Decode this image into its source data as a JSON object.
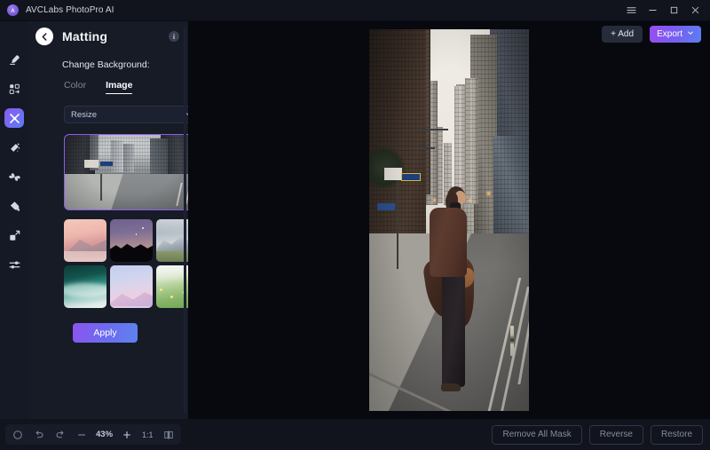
{
  "titlebar": {
    "app_name": "AVCLabs PhotoPro AI",
    "logo_icon": "app-logo-icon",
    "controls": [
      {
        "name": "menu-icon",
        "label": "☰"
      },
      {
        "name": "minimize-icon",
        "label": "─"
      },
      {
        "name": "maximize-icon",
        "label": "□"
      },
      {
        "name": "close-icon",
        "label": "✕"
      }
    ]
  },
  "top_actions": {
    "add_label": "+ Add",
    "export_label": "Export",
    "export_chevron_icon": "chevron-down-icon"
  },
  "rail": {
    "items": [
      {
        "name": "sidebar-item-retouch",
        "icon": "eraser-icon",
        "active": false
      },
      {
        "name": "sidebar-item-background",
        "icon": "background-swap-icon",
        "active": false
      },
      {
        "name": "sidebar-item-matting",
        "icon": "matting-icon",
        "active": true
      },
      {
        "name": "sidebar-item-enhance",
        "icon": "magic-wand-icon",
        "active": false
      },
      {
        "name": "sidebar-item-effects",
        "icon": "clover-icon",
        "active": false
      },
      {
        "name": "sidebar-item-colorize",
        "icon": "paint-bucket-icon",
        "active": false
      },
      {
        "name": "sidebar-item-upscale",
        "icon": "expand-icon",
        "active": false
      },
      {
        "name": "sidebar-item-adjust",
        "icon": "sliders-icon",
        "active": false
      }
    ]
  },
  "panel": {
    "back_icon": "back-arrow-icon",
    "title": "Matting",
    "info_icon": "info-icon",
    "info_label": "i",
    "section_label": "Change Background:",
    "tabs": [
      {
        "label": "Color",
        "active": false
      },
      {
        "label": "Image",
        "active": true
      }
    ],
    "select": {
      "value": "Resize",
      "chevron_icon": "chevron-down-icon"
    },
    "selected_thumbnail": "city-street-thumbnail",
    "thumbnails": [
      {
        "name": "background-thumb-pink-mountain"
      },
      {
        "name": "background-thumb-night-sky"
      },
      {
        "name": "background-thumb-snow-mountain"
      },
      {
        "name": "background-thumb-teal-wave"
      },
      {
        "name": "background-thumb-pastel-sky"
      },
      {
        "name": "background-thumb-green-meadow"
      }
    ],
    "apply_label": "Apply"
  },
  "canvas": {
    "photo_alt": "person-in-brown-coat-on-city-street"
  },
  "bottombar": {
    "tools": [
      {
        "name": "reset-button",
        "icon": "circle-reset-icon"
      },
      {
        "name": "undo-button",
        "icon": "undo-icon"
      },
      {
        "name": "redo-button",
        "icon": "redo-icon"
      },
      {
        "name": "zoom-out-button",
        "icon": "minus-icon"
      }
    ],
    "zoom_level": "43%",
    "zoom_in_icon": "plus-icon",
    "ratio_label": "1:1",
    "compare_icon": "split-compare-icon",
    "actions": [
      {
        "name": "remove-all-mask-button",
        "label": "Remove All Mask"
      },
      {
        "name": "reverse-button",
        "label": "Reverse"
      },
      {
        "name": "restore-button",
        "label": "Restore"
      }
    ]
  },
  "colors": {
    "accent_purple": "#8a5cf0",
    "accent_blue": "#5b7ef2",
    "panel_bg": "#161b26",
    "rail_bg": "#141925",
    "canvas_bg": "#07090f",
    "titlebar_bg": "#11141d"
  }
}
